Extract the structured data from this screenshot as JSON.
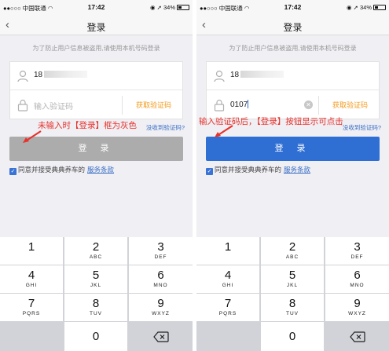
{
  "status_bar": {
    "carrier": "中国联通",
    "time": "17:42",
    "battery": "34%"
  },
  "nav": {
    "title": "登录"
  },
  "hint": "为了防止用户信息被盗用,请使用本机号码登录",
  "left": {
    "phone_value": "18",
    "code_placeholder": "输入验证码",
    "get_code": "获取验证码",
    "no_code": "没收到验证码?",
    "login": "登 录",
    "login_state": "disabled",
    "agree_text": "同意并接受典典养车的",
    "terms": "服务条款",
    "annotation": "未输入时【登录】框为灰色"
  },
  "right": {
    "phone_value": "18",
    "code_value": "0107",
    "get_code": "获取验证码",
    "no_code": "没收到验证码?",
    "login": "登 录",
    "login_state": "enabled",
    "agree_text": "同意并接受典典养车的",
    "terms": "服务条款",
    "annotation": "输入验证码后，【登录】按钮显示可点击"
  },
  "keypad": {
    "keys": [
      {
        "num": "1",
        "letters": ""
      },
      {
        "num": "2",
        "letters": "ABC"
      },
      {
        "num": "3",
        "letters": "DEF"
      },
      {
        "num": "4",
        "letters": "GHI"
      },
      {
        "num": "5",
        "letters": "JKL"
      },
      {
        "num": "6",
        "letters": "MNO"
      },
      {
        "num": "7",
        "letters": "PQRS"
      },
      {
        "num": "8",
        "letters": "TUV"
      },
      {
        "num": "9",
        "letters": "WXYZ"
      },
      {
        "num": "0",
        "letters": ""
      }
    ]
  },
  "colors": {
    "accent_orange": "#f39a1b",
    "login_enabled": "#2f6fd3",
    "login_disabled": "#acacac",
    "annotation_red": "#e8322b",
    "link_blue": "#3a6fc4"
  }
}
